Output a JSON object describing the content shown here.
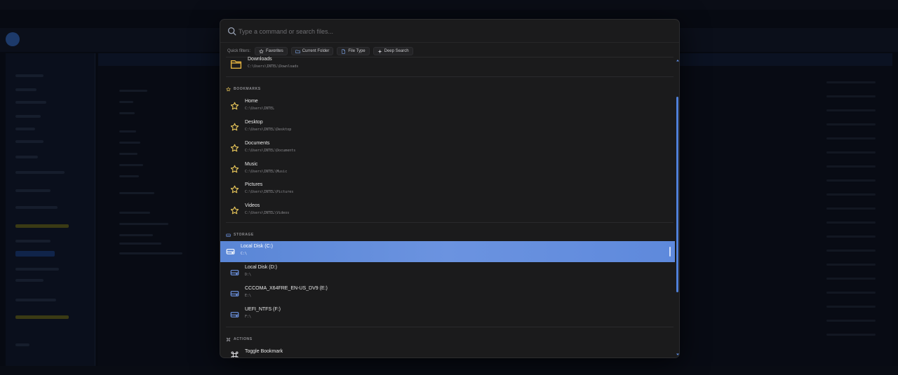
{
  "search": {
    "placeholder": "Type a command or search files..."
  },
  "filters": {
    "label": "Quick filters:",
    "chips": [
      {
        "label": "Favorites",
        "icon": "star-icon"
      },
      {
        "label": "Current Folder",
        "icon": "folder-icon"
      },
      {
        "label": "File Type",
        "icon": "file-icon"
      },
      {
        "label": "Deep Search",
        "icon": "sparkle-icon"
      }
    ]
  },
  "recent": {
    "title": "Downloads",
    "path": "C:\\Users\\INTEL\\Downloads",
    "icon": "folder-icon"
  },
  "bookmarks": {
    "heading": "BOOKMARKS",
    "items": [
      {
        "title": "Home",
        "path": "C:\\Users\\INTEL"
      },
      {
        "title": "Desktop",
        "path": "C:\\Users\\INTEL\\Desktop"
      },
      {
        "title": "Documents",
        "path": "C:\\Users\\INTEL\\Documents"
      },
      {
        "title": "Music",
        "path": "C:\\Users\\INTEL\\Music"
      },
      {
        "title": "Pictures",
        "path": "C:\\Users\\INTEL\\Pictures"
      },
      {
        "title": "Videos",
        "path": "C:\\Users\\INTEL\\Videos"
      }
    ]
  },
  "storage": {
    "heading": "STORAGE",
    "items": [
      {
        "title": "Local Disk (C:)",
        "path": "C:\\",
        "selected": true
      },
      {
        "title": "Local Disk (D:)",
        "path": "D:\\"
      },
      {
        "title": "CCCOMA_X64FRE_EN-US_DV9 (E:)",
        "path": "E:\\"
      },
      {
        "title": "UEFI_NTFS (F:)",
        "path": "F:\\"
      }
    ]
  },
  "actions": {
    "heading": "ACTIONS",
    "items": [
      {
        "title": "Toggle Bookmark"
      }
    ]
  },
  "colors": {
    "accent": "#5a86d6",
    "star": "#e8c65a",
    "folder": "#e3b341",
    "drive": "#6f97e8"
  }
}
